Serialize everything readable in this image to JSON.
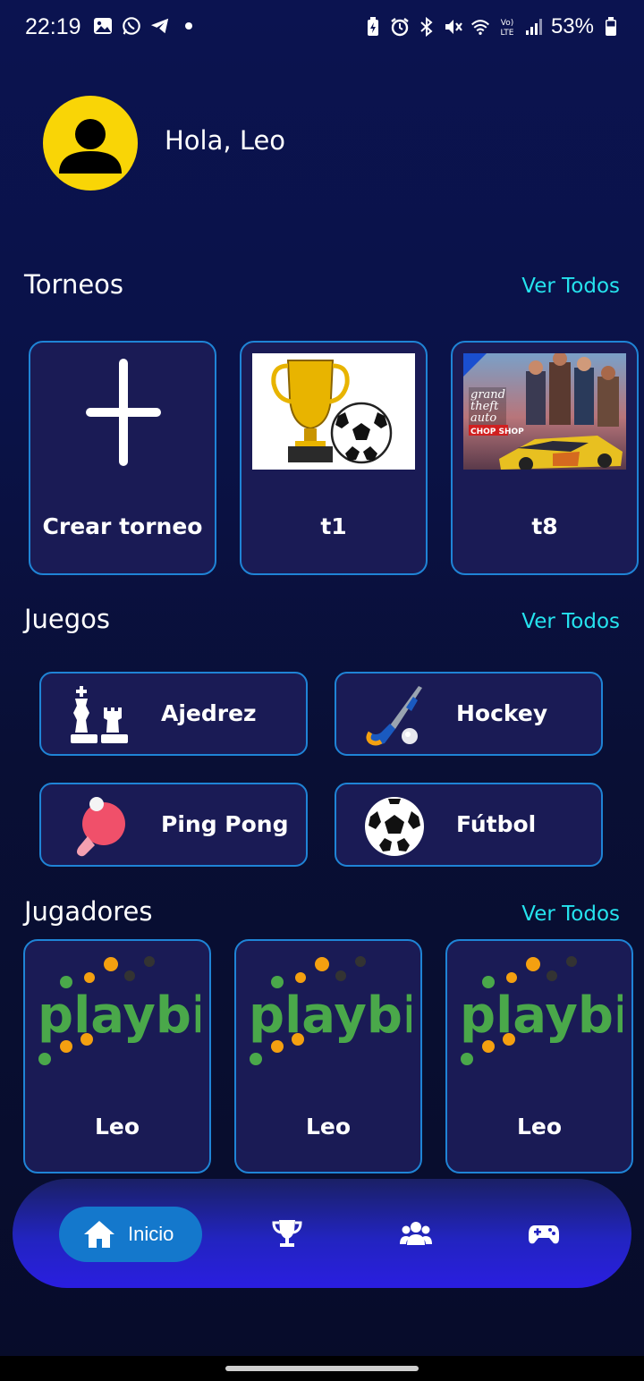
{
  "status_bar": {
    "time": "22:19",
    "battery": "53%",
    "icons_left": [
      "gallery-icon",
      "whatsapp-icon",
      "telegram-icon",
      "dot-icon"
    ],
    "icons_right": [
      "battery-saver-icon",
      "alarm-icon",
      "bluetooth-icon",
      "mute-icon",
      "wifi-icon",
      "volte-icon",
      "signal-icon",
      "battery-icon"
    ]
  },
  "header": {
    "greeting": "Hola, Leo"
  },
  "tournaments": {
    "title": "Torneos",
    "see_all": "Ver Todos",
    "create_label": "Crear torneo",
    "items": [
      {
        "label": "t1",
        "image": "trophy-soccer-image"
      },
      {
        "label": "t8",
        "image": "gta-chop-shop-image"
      }
    ]
  },
  "games": {
    "title": "Juegos",
    "see_all": "Ver Todos",
    "items": [
      {
        "label": "Ajedrez",
        "icon": "chess-icon"
      },
      {
        "label": "Hockey",
        "icon": "hockey-stick-icon"
      },
      {
        "label": "Ping Pong",
        "icon": "ping-pong-icon"
      },
      {
        "label": "Fútbol",
        "icon": "soccer-ball-icon"
      }
    ]
  },
  "players": {
    "title": "Jugadores",
    "see_all": "Ver Todos",
    "logo_text": "playbit",
    "items": [
      {
        "name": "Leo"
      },
      {
        "name": "Leo"
      },
      {
        "name": "Leo"
      }
    ]
  },
  "nav": {
    "home_label": "Inicio",
    "items": [
      "home-icon",
      "trophy-icon",
      "group-icon",
      "gamepad-icon"
    ]
  },
  "colors": {
    "background": "#0b1350",
    "card": "#1a1b55",
    "card_border": "#1f84d6",
    "accent_link": "#25e3ee",
    "avatar": "#f9d506",
    "nav_active": "#1478cc"
  }
}
